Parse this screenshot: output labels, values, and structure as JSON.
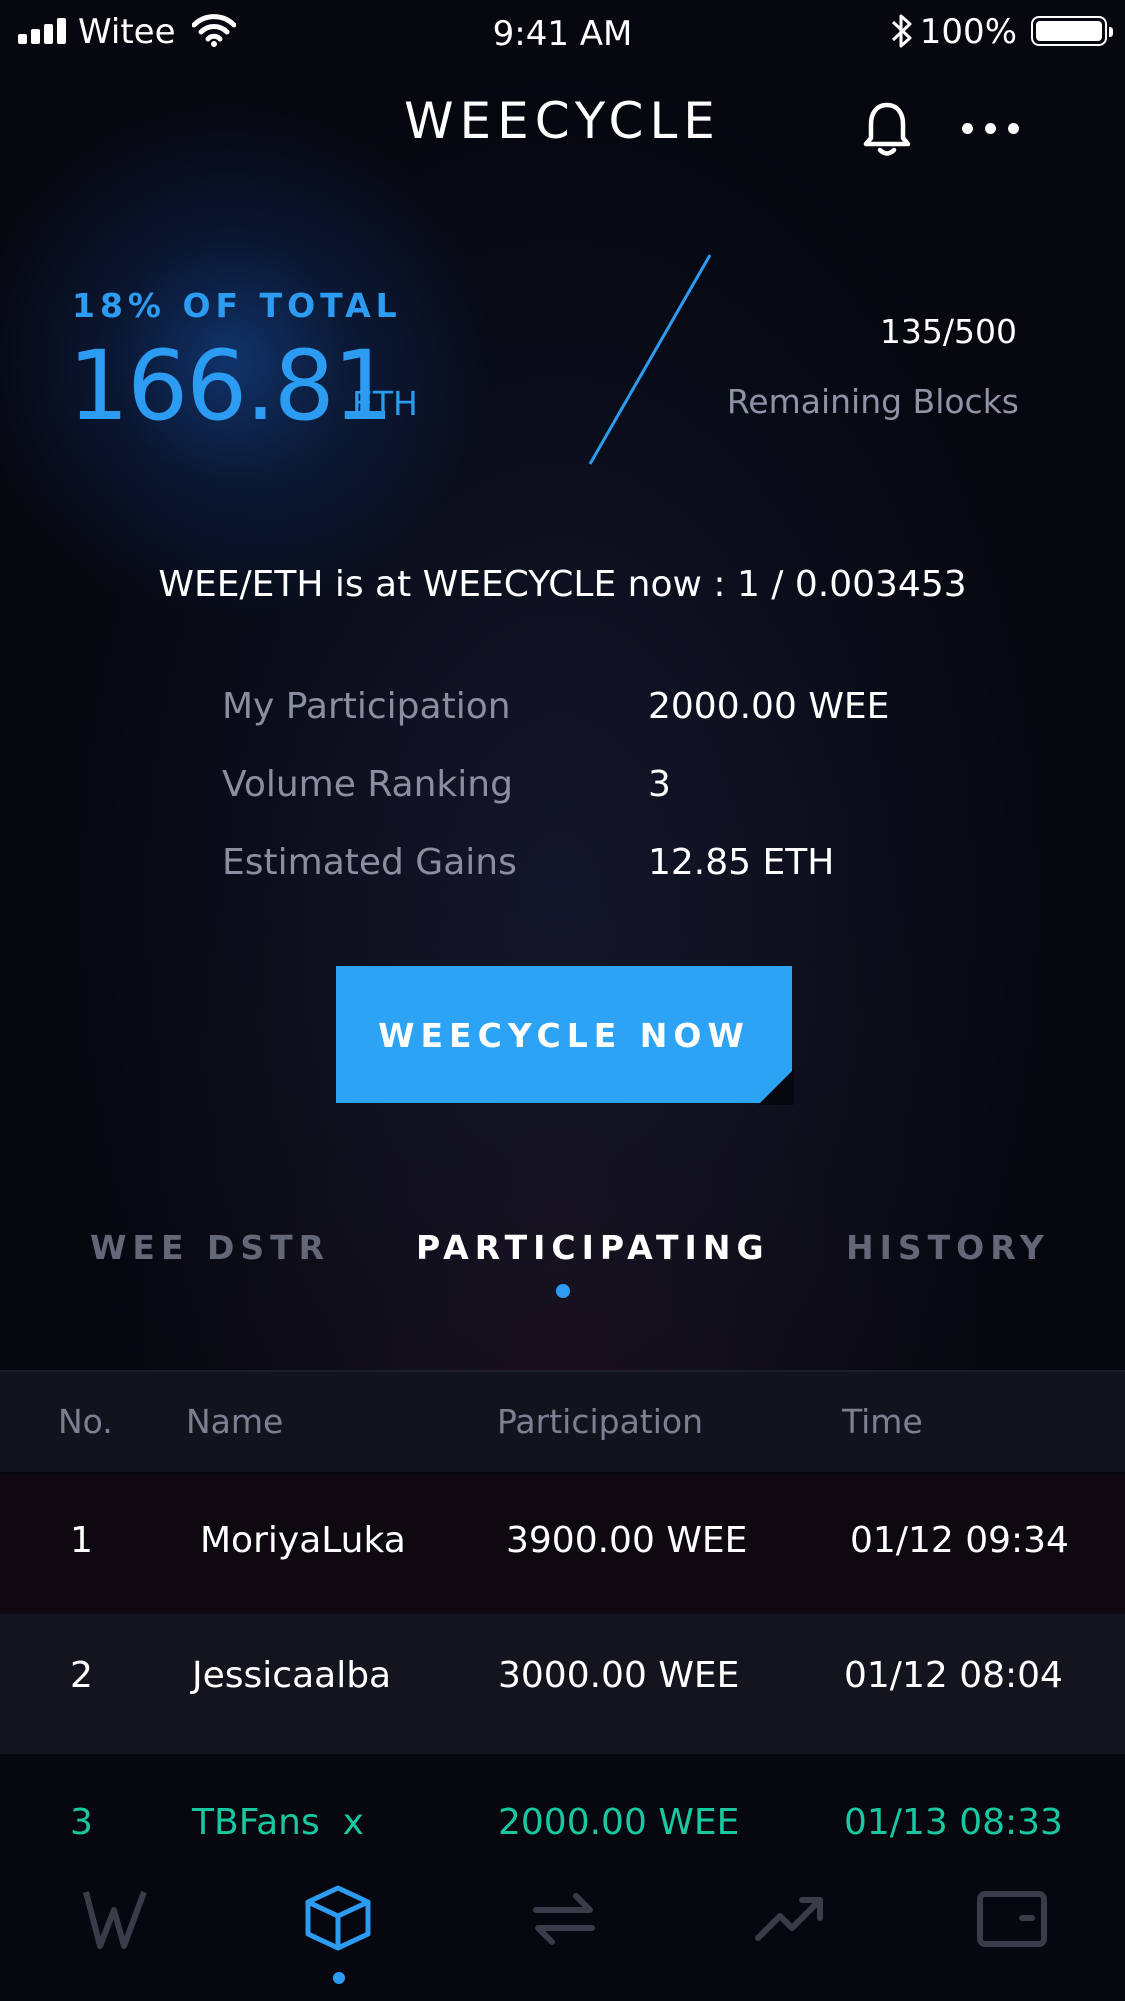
{
  "status_bar": {
    "carrier": "Witee",
    "time": "9:41 AM",
    "battery": "100%"
  },
  "header": {
    "title": "WEECYCLE"
  },
  "hero": {
    "share_label": "18% OF TOTAL",
    "amount": "166.81",
    "amount_unit": "ETH",
    "blocks": "135/500",
    "blocks_label": "Remaining Blocks"
  },
  "rate_text": "WEE/ETH is at WEECYCLE now :  1 / 0.003453",
  "info": [
    {
      "label": "My Participation",
      "value": "2000.00 WEE"
    },
    {
      "label": "Volume Ranking",
      "value": "3"
    },
    {
      "label": "Estimated Gains",
      "value": "12.85 ETH"
    }
  ],
  "cta_label": "WEECYCLE NOW",
  "tabs": [
    {
      "label": "WEE DSTR",
      "active": false
    },
    {
      "label": "PARTICIPATING",
      "active": true
    },
    {
      "label": "HISTORY",
      "active": false
    }
  ],
  "table": {
    "headers": [
      "No.",
      "Name",
      "Participation",
      "Time"
    ],
    "rows": [
      {
        "no": "1",
        "name": "MoriyaLuka",
        "participation": "3900.00 WEE",
        "time": "01/12 09:34"
      },
      {
        "no": "2",
        "name": "Jessicaalba",
        "participation": "3000.00 WEE",
        "time": "01/12 08:04"
      },
      {
        "no": "3",
        "name": "TBFans  x",
        "participation": "2000.00 WEE",
        "time": "01/13 08:33"
      }
    ]
  },
  "bottom_nav": [
    {
      "icon": "weecycle-logo-icon",
      "active": false
    },
    {
      "icon": "cube-icon",
      "active": true
    },
    {
      "icon": "swap-arrows-icon",
      "active": false
    },
    {
      "icon": "trend-up-icon",
      "active": false
    },
    {
      "icon": "wallet-icon",
      "active": false
    }
  ],
  "colors": {
    "accent": "#2c9cf2",
    "highlight_row": "#19c8a1",
    "background": "#06070f"
  }
}
